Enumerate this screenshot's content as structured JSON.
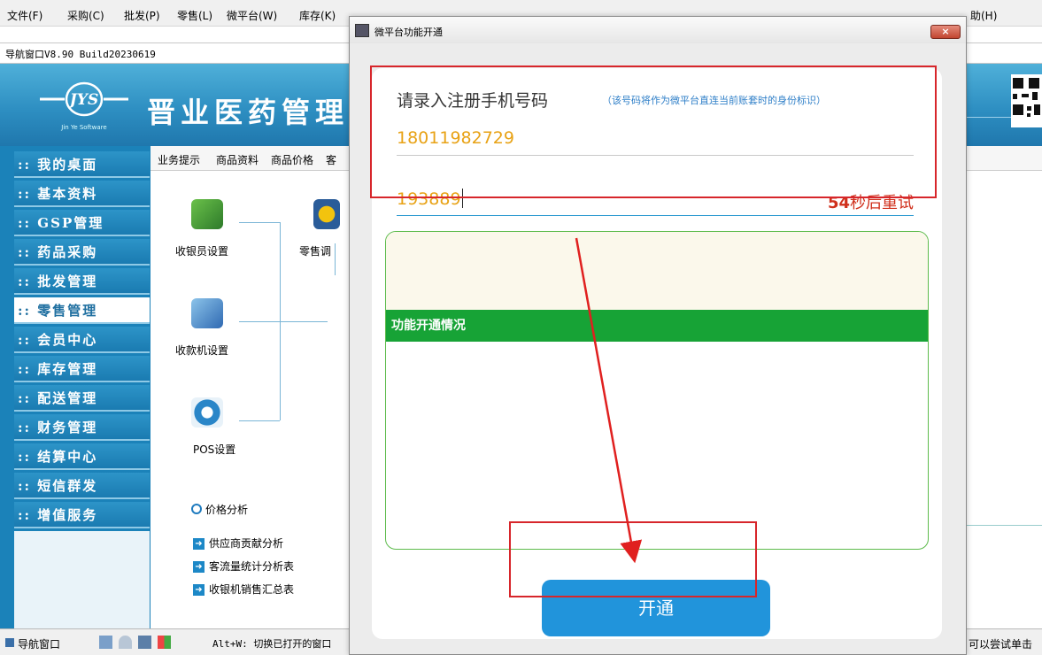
{
  "menubar": {
    "items": [
      "文件(F)",
      "采购(C)",
      "批发(P)",
      "零售(L)",
      "微平台(W)",
      "库存(K)"
    ],
    "help": "助(H)"
  },
  "nav_window": {
    "title": "导航窗口V8.90 Build20230619"
  },
  "banner": {
    "brand": "晋业医药管理",
    "logo_text": "JYS",
    "logo_sub": "Jin Ye Software"
  },
  "sidebar": {
    "items": [
      {
        "label": ":: 我的桌面",
        "active": false
      },
      {
        "label": ":: 基本资料",
        "active": false
      },
      {
        "label": ":: GSP管理",
        "active": false
      },
      {
        "label": ":: 药品采购",
        "active": false
      },
      {
        "label": ":: 批发管理",
        "active": false
      },
      {
        "label": ":: 零售管理",
        "active": true
      },
      {
        "label": ":: 会员中心",
        "active": false
      },
      {
        "label": ":: 库存管理",
        "active": false
      },
      {
        "label": ":: 配送管理",
        "active": false
      },
      {
        "label": ":: 财务管理",
        "active": false
      },
      {
        "label": ":: 结算中心",
        "active": false
      },
      {
        "label": ":: 短信群发",
        "active": false
      },
      {
        "label": ":: 增值服务",
        "active": false
      }
    ]
  },
  "content": {
    "tabs": [
      "业务提示",
      "商品资料",
      "商品价格",
      "客"
    ],
    "apps": [
      "收银员设置",
      "零售调",
      "收款机设置",
      "POS设置"
    ],
    "section_title": "价格分析",
    "links": [
      "供应商贡献分析",
      "客流量统计分析表",
      "收银机销售汇总表"
    ]
  },
  "statusbar": {
    "nav_label": "导航窗口",
    "shortcut_hint": "Alt+W: 切换已打开的窗口",
    "right_hint": "可以尝试单击"
  },
  "dialog": {
    "title": "微平台功能开通",
    "close_label": "×",
    "heading": "请录入注册手机号码",
    "hint": "（该号码将作为微平台直连当前账套时的身份标识）",
    "phone": "18011982729",
    "code": "193889",
    "countdown_seconds": "54",
    "countdown_suffix": "秒后重试",
    "status_header": "功能开通情况",
    "open_button": "开通"
  },
  "colors": {
    "accent": "#2194db",
    "annotation": "#d7262b",
    "status_green": "#17a336",
    "input_text": "#e8a215"
  }
}
